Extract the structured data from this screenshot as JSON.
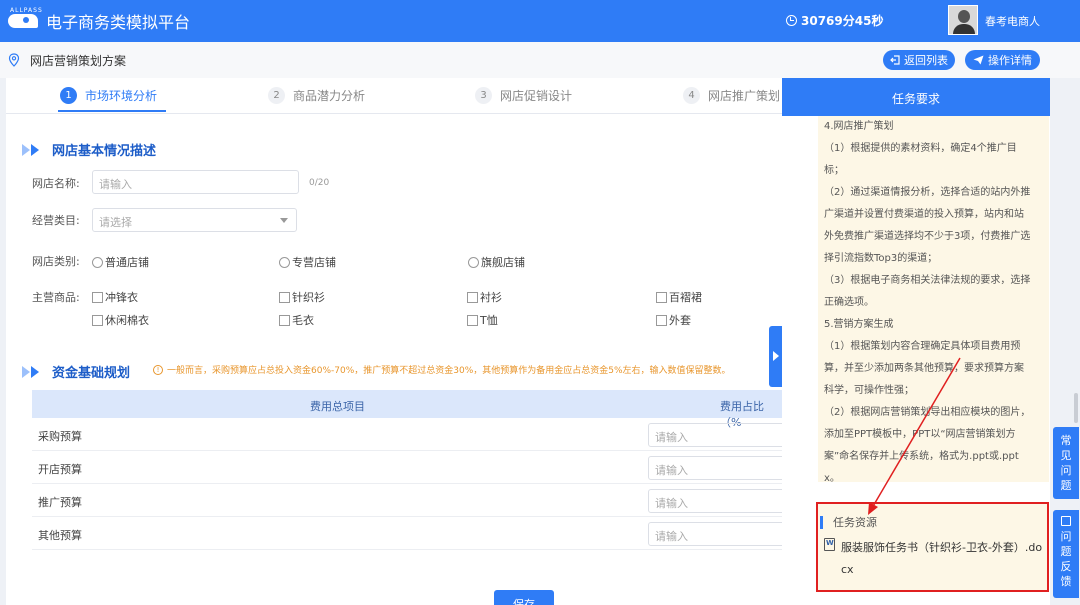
{
  "app": {
    "title": "电子商务类模拟平台",
    "logo_text": "ALLPASS",
    "timer": "30769分45秒",
    "username": "春考电商人"
  },
  "subheader": {
    "page_name": "网店营销策划方案",
    "back_button": "返回列表",
    "help_button": "操作详情"
  },
  "steps": [
    {
      "num": "1",
      "label": "市场环境分析",
      "active": true
    },
    {
      "num": "2",
      "label": "商品潜力分析",
      "active": false
    },
    {
      "num": "3",
      "label": "网店促销设计",
      "active": false
    },
    {
      "num": "4",
      "label": "网店推广策划",
      "active": false
    }
  ],
  "section1": {
    "title": "网店基本情况描述",
    "shop_name_label": "网店名称:",
    "shop_name_placeholder": "请输入",
    "shop_name_counter": "0/20",
    "category_label": "经营类目:",
    "category_placeholder": "请选择",
    "shop_type_label": "网店类别:",
    "shop_types": [
      "普通店铺",
      "专营店铺",
      "旗舰店铺"
    ],
    "goods_label": "主营商品:",
    "goods": [
      "冲锋衣",
      "针织衫",
      "衬衫",
      "百褶裙",
      "休闲棉衣",
      "毛衣",
      "T恤",
      "外套"
    ]
  },
  "section2": {
    "title": "资金基础规划",
    "warning": "一般而言，采购预算应占总投入资金60%-70%，推广预算不超过总资金30%，其他预算作为备用金应占总资金5%左右，输入数值保留整数。",
    "col_item": "费用总项目",
    "col_ratio": "费用占比（%",
    "rows": [
      {
        "label": "采购预算",
        "placeholder": "请输入"
      },
      {
        "label": "开店预算",
        "placeholder": "请输入"
      },
      {
        "label": "推广预算",
        "placeholder": "请输入"
      },
      {
        "label": "其他预算",
        "placeholder": "请输入"
      }
    ],
    "save_button": "保存"
  },
  "task_panel": {
    "title": "任务要求",
    "lines": [
      "4.网店推广策划",
      "（1）根据提供的素材资料，确定4个推广目",
      "标；",
      "（2）通过渠道情报分析，选择合适的站内外推",
      "广渠道并设置付费渠道的投入预算，站内和站",
      "外免费推广渠道选择均不少于3项，付费推广选",
      "择引流指数Top3的渠道；",
      "（3）根据电子商务相关法律法规的要求，选择",
      "正确选项。",
      "5.营销方案生成",
      "（1）根据策划内容合理确定具体项目费用预",
      "算，并至少添加两条其他预算，要求预算方案",
      "科学，可操作性强；",
      "（2）根据网店营销策划导出相应模块的图片，",
      "添加至PPT模板中，PPT以“网店营销策划方",
      "案”命名保存并上传系统，格式为.ppt或.ppt",
      "x。"
    ],
    "resource_title": "任务资源",
    "resource_file": "服装服饰任务书（针织衫-卫衣-外套）.docx"
  },
  "side": {
    "faq": "常见问题",
    "feedback": "问题反馈"
  },
  "colors": {
    "primary": "#2f7cf6",
    "warning": "#e8962d",
    "highlight_border": "#e02020"
  }
}
